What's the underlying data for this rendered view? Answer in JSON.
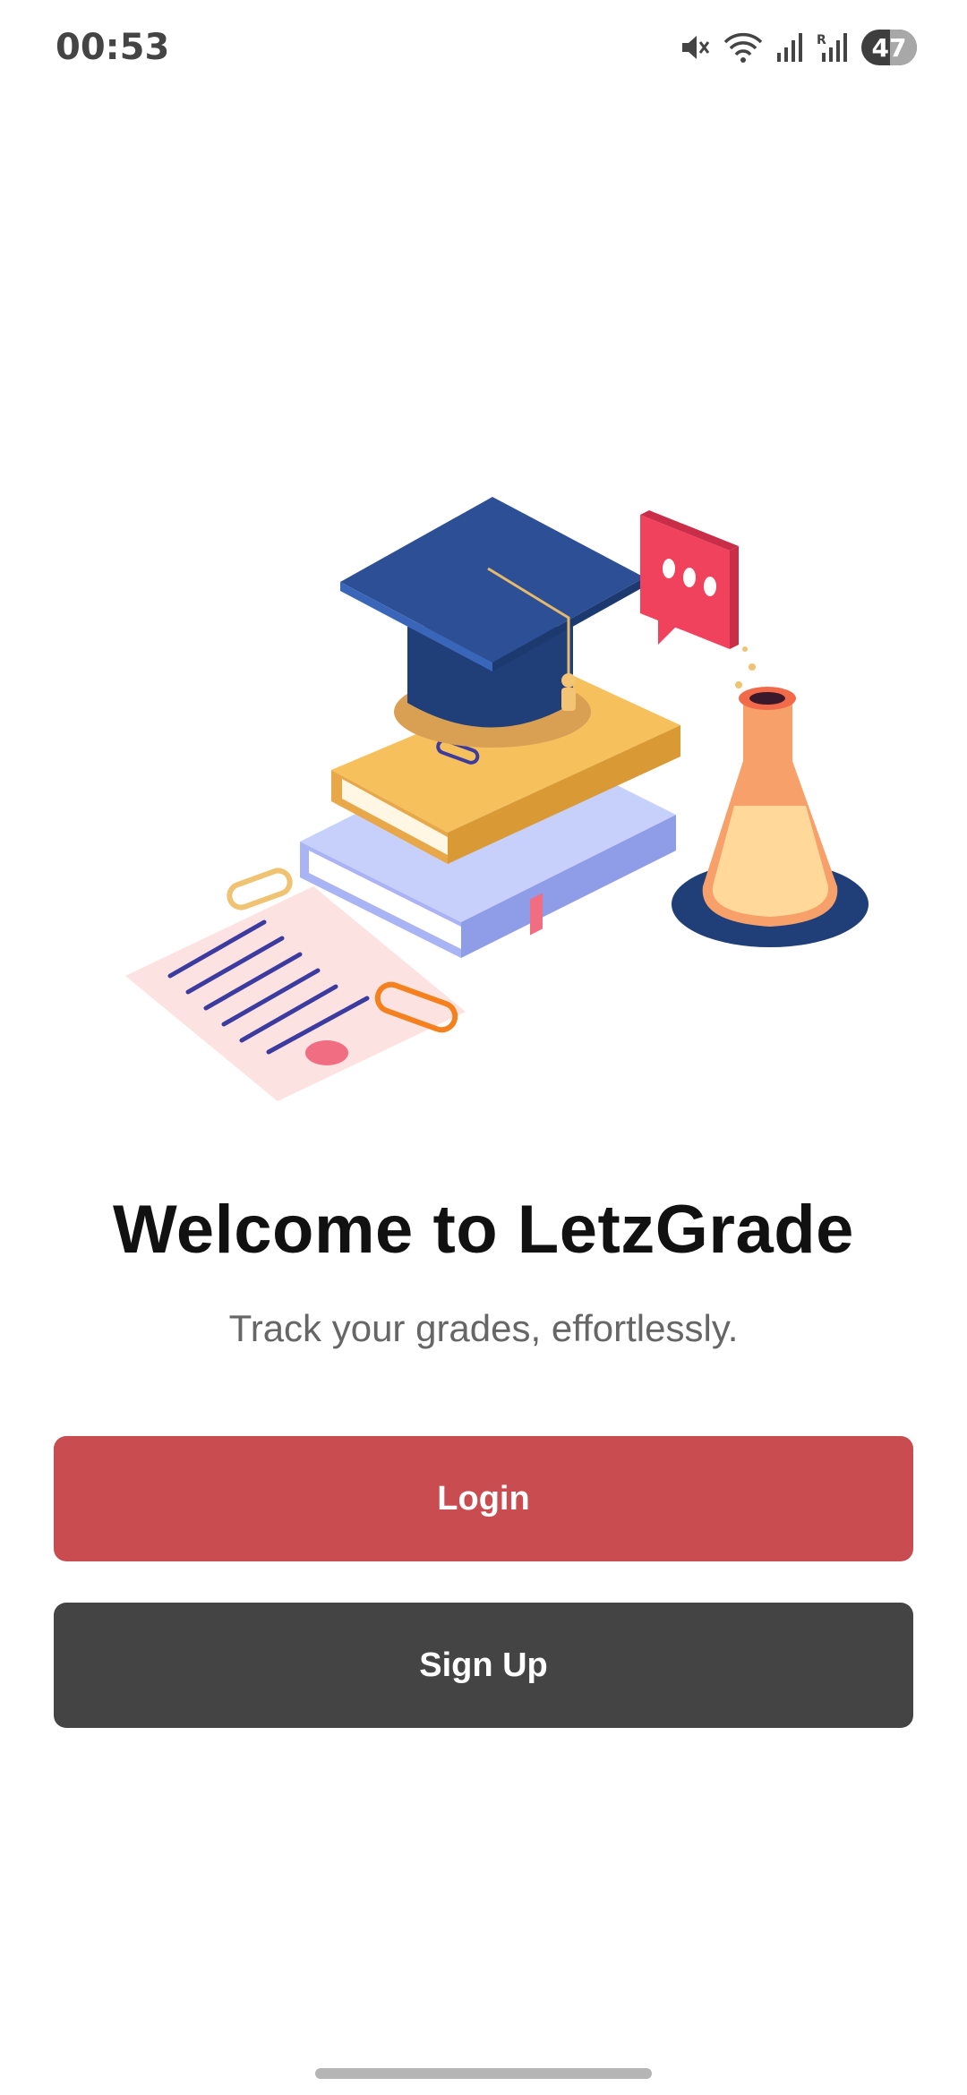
{
  "status_bar": {
    "time": "00:53",
    "battery_level": "47",
    "icons": [
      "mute-icon",
      "wifi-icon",
      "signal-icon",
      "signal-r-icon",
      "battery-icon"
    ]
  },
  "illustration": {
    "icons": [
      "graduation-cap-icon",
      "books-icon",
      "chat-bubble-icon",
      "flask-icon",
      "paper-icon",
      "paperclip-icon",
      "bookmark-icon"
    ],
    "colors": {
      "cap": "#284a8a",
      "book_top": "#f6c15c",
      "book_bottom": "#b9c3f5",
      "bubble": "#f1425d",
      "flask": "#f7a06a",
      "paper": "#fde0e0",
      "lines": "#3c3ba0"
    }
  },
  "welcome": {
    "title": "Welcome to LetzGrade",
    "subtitle": "Track your grades, effortlessly."
  },
  "buttons": {
    "login": "Login",
    "signup": "Sign Up"
  },
  "colors": {
    "login_bg": "#c94c50",
    "signup_bg": "#444444"
  }
}
